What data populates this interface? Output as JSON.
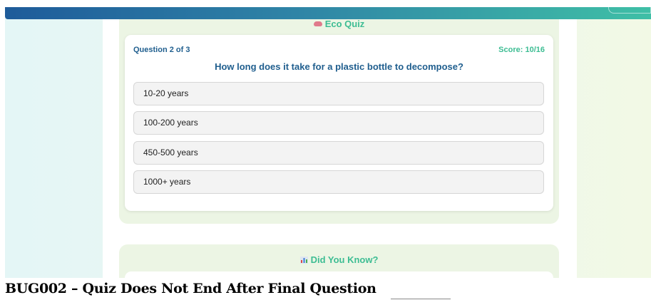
{
  "quiz": {
    "title": "Eco Quiz",
    "counter": "Question 2 of 3",
    "score": "Score: 10/16",
    "question": "How long does it take for a plastic bottle to decompose?",
    "options": [
      "10-20 years",
      "100-200 years",
      "450-500 years",
      "1000+ years"
    ]
  },
  "facts": {
    "title": "Did You Know?"
  },
  "caption": "BUG002 – Quiz Does Not End After Final Question",
  "colors": {
    "accent_green": "#3dbd93",
    "heading_blue": "#1f5e8e",
    "panel_bg": "#ecf5e4",
    "topbar_start": "#1e5b9a",
    "topbar_end": "#3fbfa6"
  }
}
